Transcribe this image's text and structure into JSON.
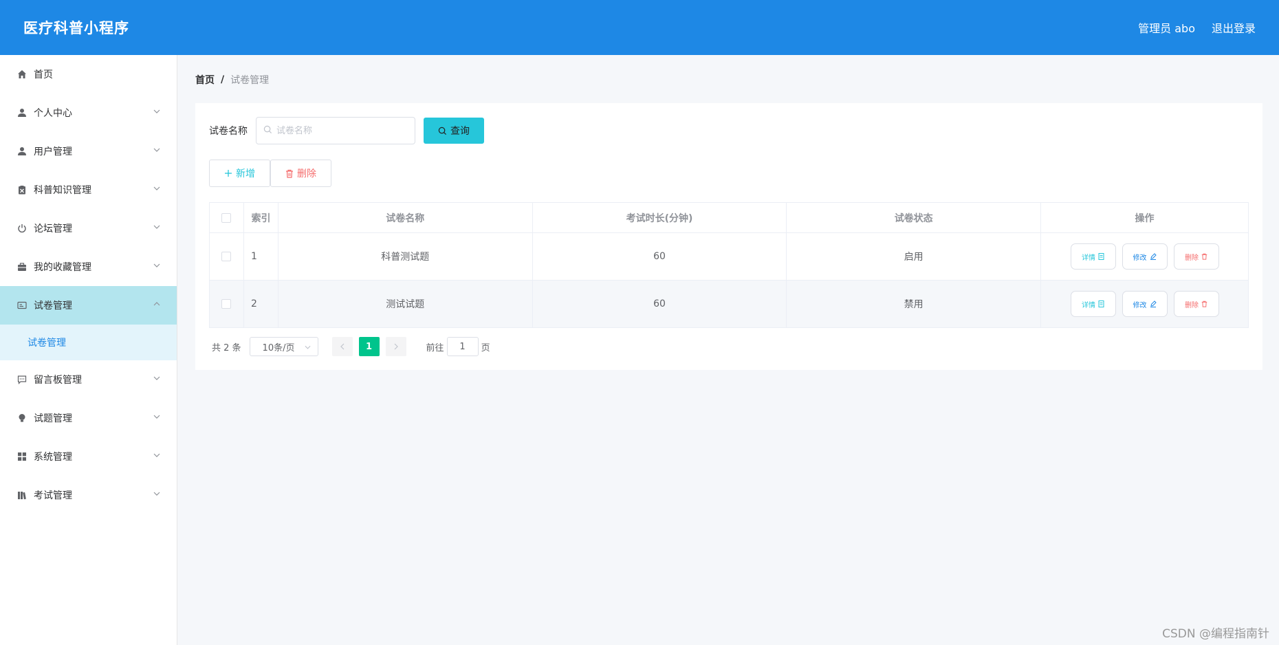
{
  "header": {
    "title": "医疗科普小程序",
    "user_label": "管理员 abo",
    "logout_label": "退出登录"
  },
  "sidebar": {
    "items": [
      {
        "label": "首页",
        "icon": "home-icon"
      },
      {
        "label": "个人中心",
        "icon": "user-icon"
      },
      {
        "label": "用户管理",
        "icon": "user-icon"
      },
      {
        "label": "科普知识管理",
        "icon": "clipboard-icon"
      },
      {
        "label": "论坛管理",
        "icon": "power-icon"
      },
      {
        "label": "我的收藏管理",
        "icon": "briefcase-icon"
      },
      {
        "label": "试卷管理",
        "icon": "id-card-icon"
      },
      {
        "label": "留言板管理",
        "icon": "chat-icon"
      },
      {
        "label": "试题管理",
        "icon": "bulb-icon"
      },
      {
        "label": "系统管理",
        "icon": "grid-icon"
      },
      {
        "label": "考试管理",
        "icon": "books-icon"
      }
    ],
    "submenu": {
      "label": "试卷管理"
    }
  },
  "breadcrumb": {
    "home": "首页",
    "separator": "/",
    "current": "试卷管理"
  },
  "search": {
    "label": "试卷名称",
    "placeholder": "试卷名称",
    "query_label": "查询"
  },
  "actions": {
    "add_label": "新增",
    "delete_label": "删除"
  },
  "table": {
    "headers": {
      "index": "索引",
      "name": "试卷名称",
      "duration": "考试时长(分钟)",
      "status": "试卷状态",
      "ops": "操作"
    },
    "rows": [
      {
        "index": "1",
        "name": "科普测试题",
        "duration": "60",
        "status": "启用"
      },
      {
        "index": "2",
        "name": "测试试题",
        "duration": "60",
        "status": "禁用"
      }
    ],
    "op_labels": {
      "detail": "详情",
      "edit": "修改",
      "delete": "删除"
    }
  },
  "pagination": {
    "total": "共 2 条",
    "page_size": "10条/页",
    "current_page": "1",
    "goto_label": "前往",
    "goto_value": "1",
    "goto_suffix": "页"
  },
  "watermark": "CSDN @编程指南针",
  "colors": {
    "header_bg": "#1e88e5",
    "accent_cyan": "#26c6da",
    "active_menu_bg": "#b3e5ee",
    "pager_active": "#00c48c",
    "danger": "#f56c6c"
  }
}
